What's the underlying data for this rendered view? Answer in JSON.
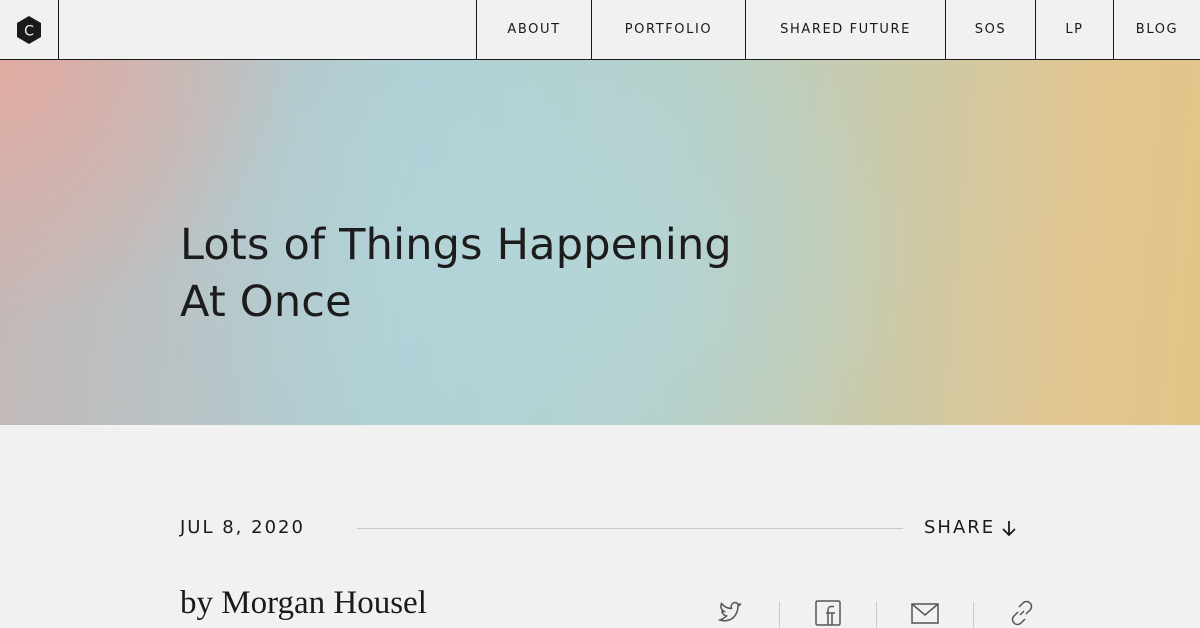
{
  "nav": {
    "logo_letter": "C",
    "items": [
      {
        "label": "ABOUT"
      },
      {
        "label": "PORTFOLIO"
      },
      {
        "label": "SHARED FUTURE"
      },
      {
        "label": "SOS"
      },
      {
        "label": "LP"
      },
      {
        "label": "BLOG"
      }
    ]
  },
  "hero": {
    "title_line1": "Lots of Things Happening",
    "title_line2": "At Once"
  },
  "article": {
    "date": "JUL 8, 2020",
    "share_label": "SHARE",
    "byline": "by Morgan Housel"
  },
  "share_icons": [
    "twitter-icon",
    "facebook-icon",
    "email-icon",
    "link-icon"
  ],
  "colors": {
    "text": "#1a1a1a",
    "background": "#f1f1f1",
    "hero_gradient": [
      "#e2aaa0",
      "#adcfd5",
      "#e3c487"
    ]
  }
}
